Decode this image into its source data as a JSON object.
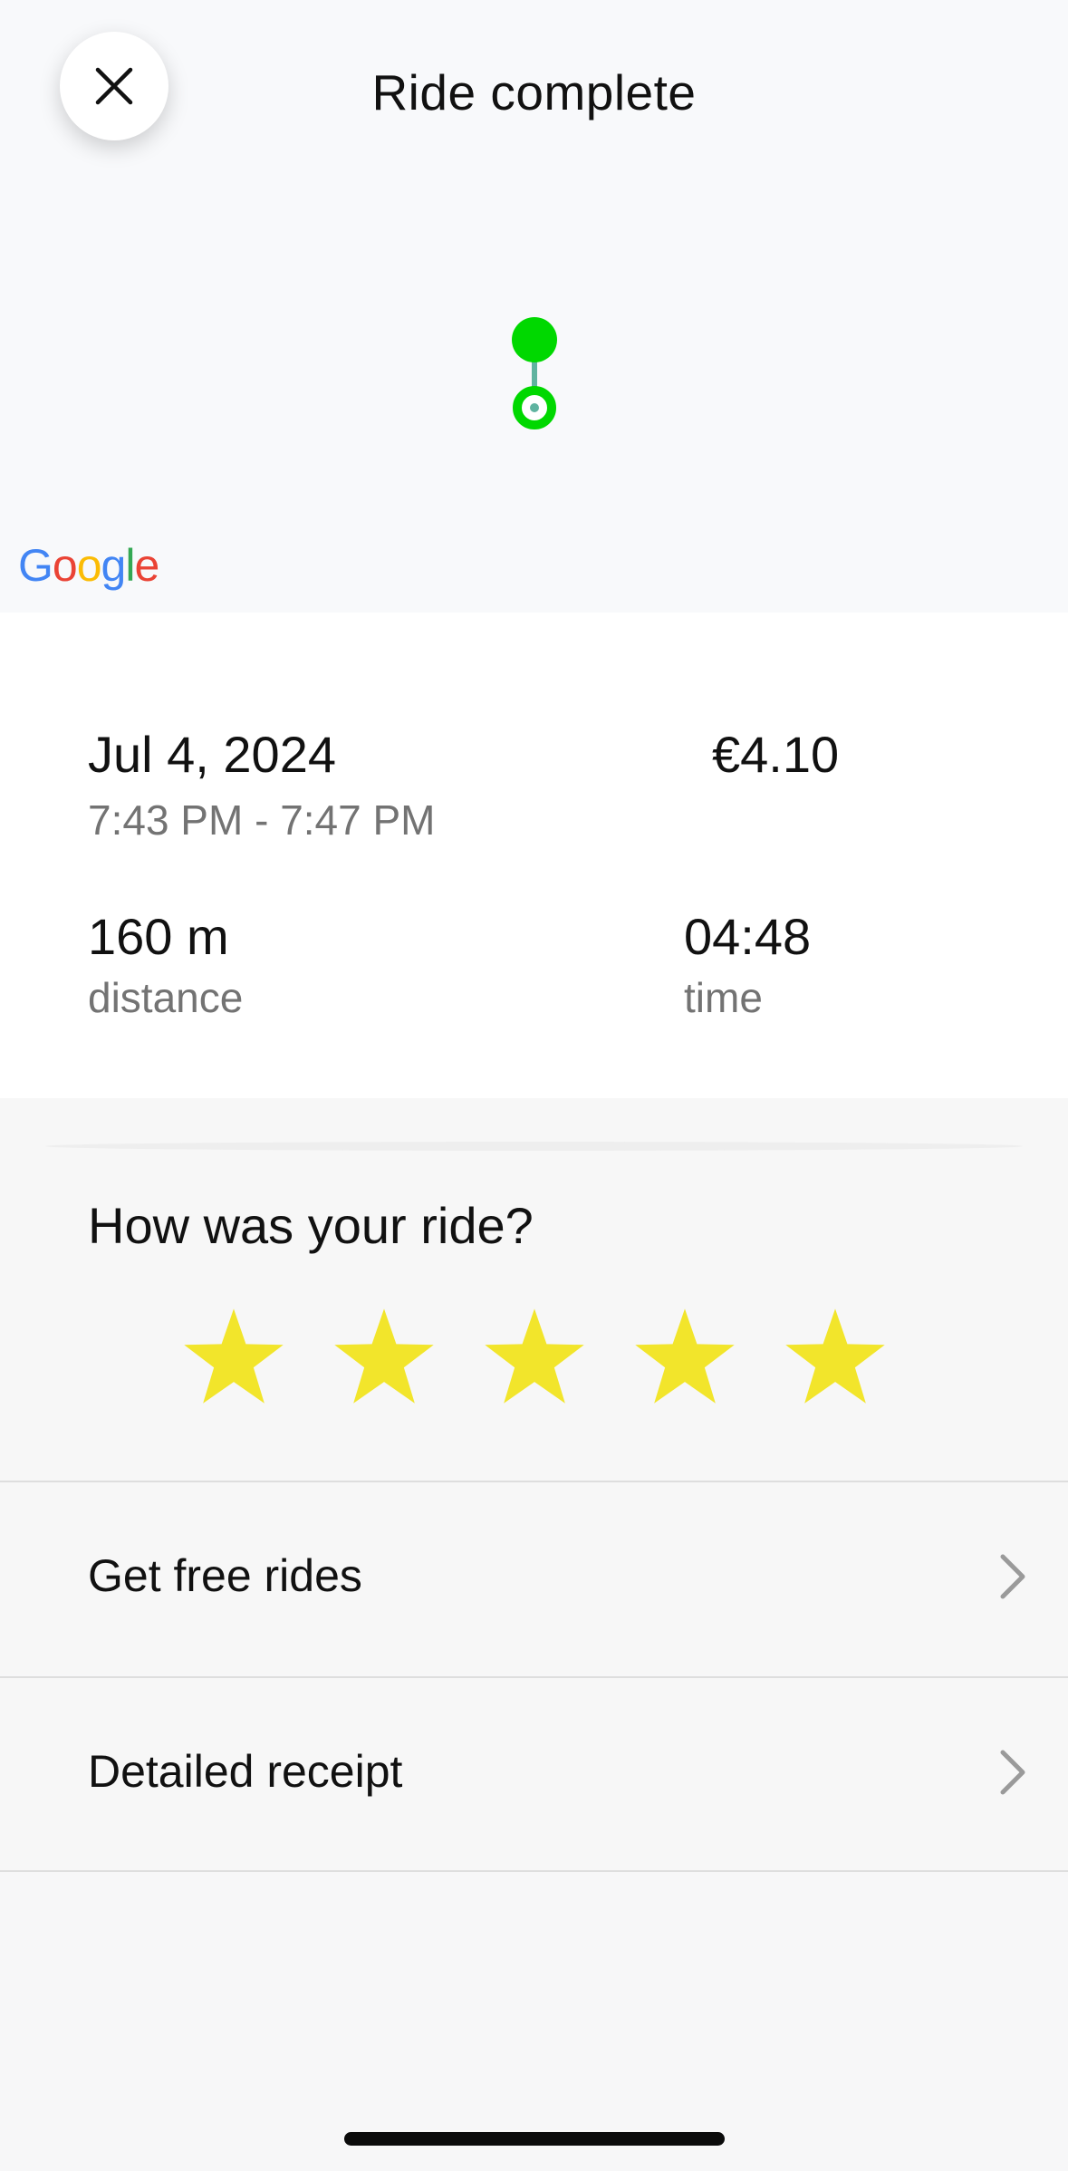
{
  "header": {
    "title": "Ride complete",
    "close_icon": "close-icon"
  },
  "map": {
    "attribution": "Google",
    "route_color": "#00d800",
    "route_line_color": "#5fb3a0"
  },
  "ride": {
    "date": "Jul 4, 2024",
    "time_range": "7:43 PM - 7:47 PM",
    "price": "€4.10",
    "distance_value": "160 m",
    "distance_label": "distance",
    "time_value": "04:48",
    "time_label": "time"
  },
  "rating": {
    "title": "How was your ride?",
    "stars": 5,
    "star_color": "#f2e52b"
  },
  "list": {
    "items": [
      {
        "label": "Get free rides",
        "icon": "chevron-right-icon"
      },
      {
        "label": "Detailed receipt",
        "icon": "chevron-right-icon"
      }
    ]
  }
}
